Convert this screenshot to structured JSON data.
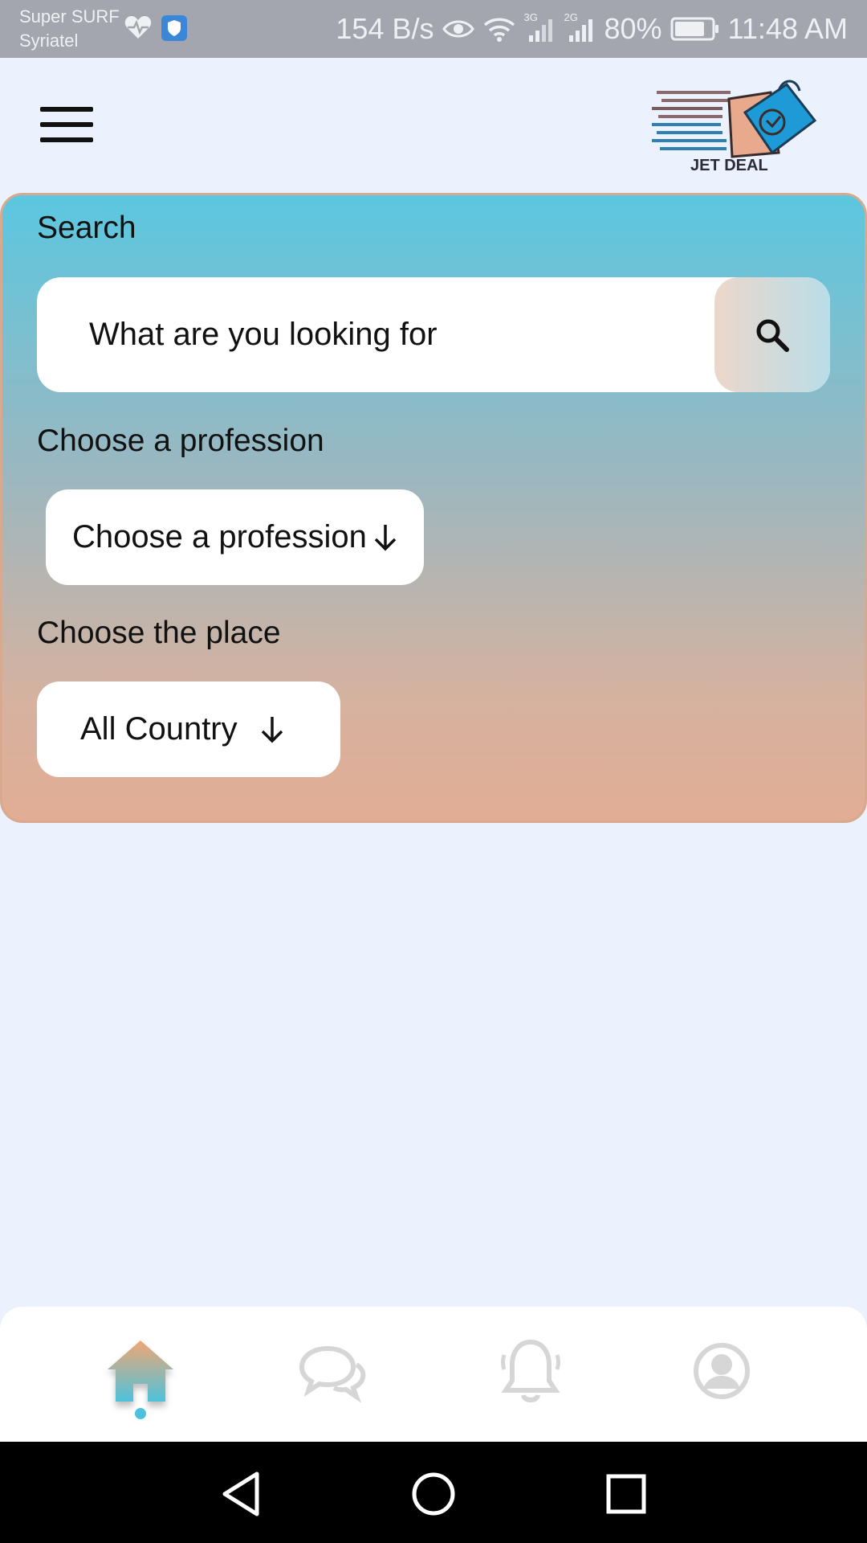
{
  "status_bar": {
    "carrier_line1": "Super SURF",
    "carrier_line2": "Syriatel",
    "net_speed": "154 B/s",
    "net_3g": "3G",
    "net_2g": "2G",
    "battery": "80%",
    "time": "11:48 AM"
  },
  "header": {
    "logo_text": "JET DEAL"
  },
  "search": {
    "label": "Search",
    "placeholder": "What are you looking for"
  },
  "profession": {
    "label": "Choose a profession",
    "selected": "Choose a profession"
  },
  "place": {
    "label": "Choose the place",
    "selected": "All Country"
  },
  "bottom_nav": {
    "items": [
      {
        "icon": "home-icon",
        "active": true
      },
      {
        "icon": "chat-icon",
        "active": false
      },
      {
        "icon": "bell-icon",
        "active": false
      },
      {
        "icon": "profile-icon",
        "active": false
      }
    ]
  },
  "colors": {
    "page_bg": "#ecf1fe",
    "card_top": "#5bc7e0",
    "card_bottom": "#e2ad94",
    "accent": "#4cc0dd",
    "inactive_icon": "#d6d6d6"
  }
}
